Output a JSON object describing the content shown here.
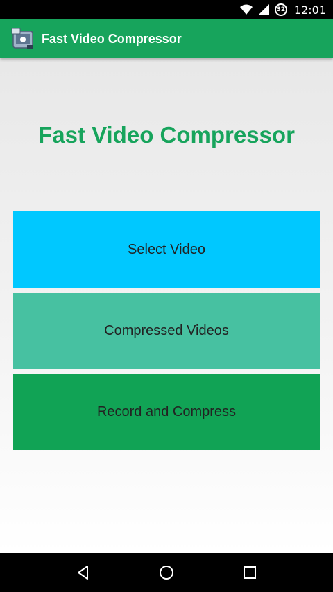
{
  "status_bar": {
    "time": "12:01",
    "battery_badge": "32",
    "icons": [
      "wifi-icon",
      "cell-signal-icon",
      "battery-icon"
    ]
  },
  "app_bar": {
    "title": "Fast Video Compressor",
    "icon": "app-logo-icon",
    "color": "#17a45c"
  },
  "main": {
    "headline": "Fast Video Compressor",
    "buttons": [
      {
        "label": "Select Video",
        "color": "#00c8ff"
      },
      {
        "label": "Compressed Videos",
        "color": "#47c1a1"
      },
      {
        "label": "Record and Compress",
        "color": "#11a355"
      }
    ]
  },
  "nav_bar": {
    "icons": [
      "back-icon",
      "home-icon",
      "recents-icon"
    ]
  }
}
